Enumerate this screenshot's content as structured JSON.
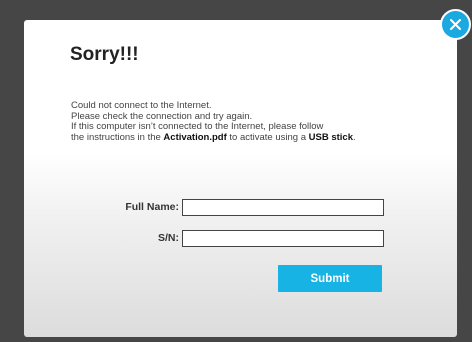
{
  "dialog": {
    "title": "Sorry!!!",
    "message": {
      "line1": "Could not connect to the Internet.",
      "line2": "Please check the connection and try again.",
      "line3": "If this computer isn’t connected to the Internet, please follow",
      "line4_prefix": "the instructions in the ",
      "line4_bold1": "Activation.pdf",
      "line4_middle": " to activate using a ",
      "line4_bold2": "USB stick",
      "line4_suffix": "."
    },
    "form": {
      "full_name_label": "Full Name:",
      "full_name_value": "",
      "sn_label": "S/N:",
      "sn_value": ""
    },
    "submit_label": "Submit",
    "close_icon": "close-icon"
  },
  "colors": {
    "accent": "#17b3e4",
    "backdrop": "#464646"
  }
}
